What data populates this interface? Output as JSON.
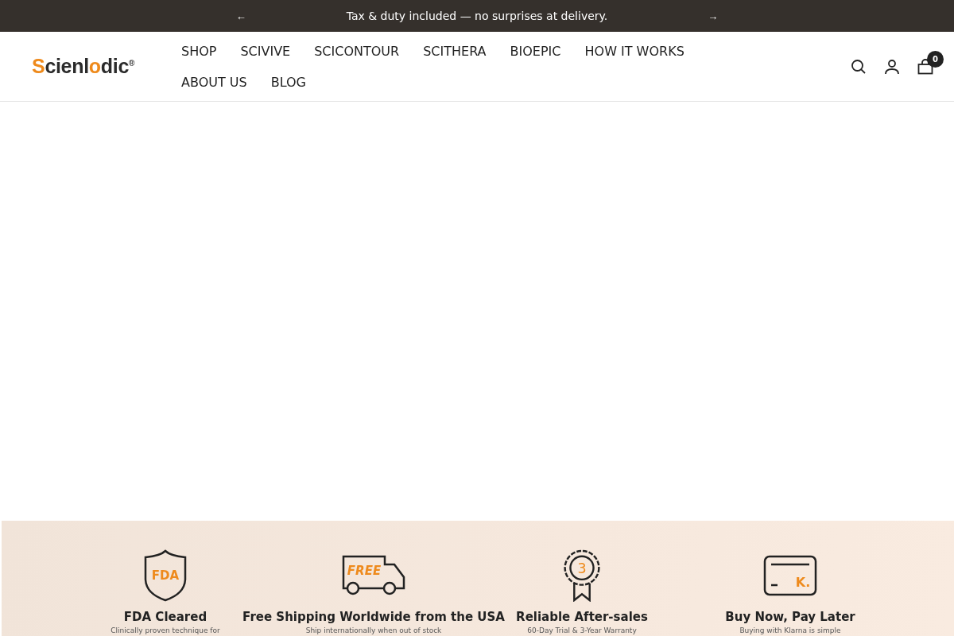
{
  "announcement": {
    "prev": "←",
    "text": "Tax & duty included — no surprises at delivery.",
    "next": "→"
  },
  "logo": {
    "parts": [
      {
        "text": "S",
        "color": "#ee8a1c"
      },
      {
        "text": "cienl",
        "color": "#2b2b2b"
      },
      {
        "text": "o",
        "color": "#ee8a1c"
      },
      {
        "text": "dic",
        "color": "#2b2b2b"
      }
    ],
    "mark": "®"
  },
  "nav": [
    "SHOP",
    "SCIVIVE",
    "SCICONTOUR",
    "SCITHERA",
    "BIOEPIC",
    "HOW IT WORKS",
    "ABOUT US",
    "BLOG"
  ],
  "cart": {
    "count": "0"
  },
  "features": [
    {
      "kind": "shield",
      "icon_text": "FDA",
      "title": "FDA Cleared",
      "subtitle": "Clinically proven technique for"
    },
    {
      "kind": "truck",
      "icon_text": "FREE",
      "title": "Free Shipping Worldwide from the USA",
      "subtitle": "Ship internationally when out of stock"
    },
    {
      "kind": "badge",
      "icon_text": "3",
      "title": "Reliable After-sales",
      "subtitle": "60-Day Trial & 3-Year Warranty"
    },
    {
      "kind": "card",
      "icon_text": "K.",
      "title": "Buy Now, Pay Later",
      "subtitle": "Buying with Klarna is simple"
    }
  ]
}
